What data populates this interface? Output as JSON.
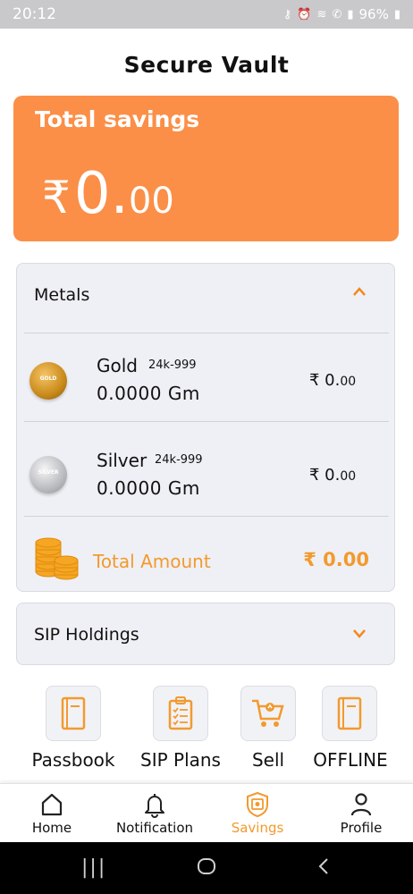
{
  "status_bar": {
    "time": "20:12",
    "battery": "96%"
  },
  "page": {
    "title": "Secure Vault"
  },
  "savings": {
    "label": "Total savings",
    "currency": "₹",
    "integer": "0.",
    "decimal": "00"
  },
  "metals": {
    "header": "Metals",
    "items": [
      {
        "name": "Gold",
        "purity": "24k-999",
        "quantity": "0.0000 Gm",
        "value_main": "₹ 0.",
        "value_dec": "00",
        "coin_text": "GOLD"
      },
      {
        "name": "Silver",
        "purity": "24k-999",
        "quantity": "0.0000 Gm",
        "value_main": "₹ 0.",
        "value_dec": "00",
        "coin_text": "SILVER"
      }
    ],
    "total_label": "Total Amount",
    "total_value": "₹ 0.00"
  },
  "sip": {
    "header": "SIP Holdings"
  },
  "actions": [
    {
      "label": "Passbook",
      "icon": "book-icon"
    },
    {
      "label": "SIP Plans",
      "icon": "clipboard-icon"
    },
    {
      "label": "Sell",
      "icon": "cart-icon"
    },
    {
      "label": "OFFLINE",
      "icon": "book-icon"
    }
  ],
  "nav": [
    {
      "label": "Home",
      "icon": "home-icon"
    },
    {
      "label": "Notification",
      "icon": "bell-icon"
    },
    {
      "label": "Savings",
      "icon": "vault-icon",
      "active": true
    },
    {
      "label": "Profile",
      "icon": "person-icon"
    }
  ],
  "colors": {
    "accent": "#fb8f48",
    "accent_text": "#f29a2e",
    "panel_bg": "#eff0f5"
  }
}
